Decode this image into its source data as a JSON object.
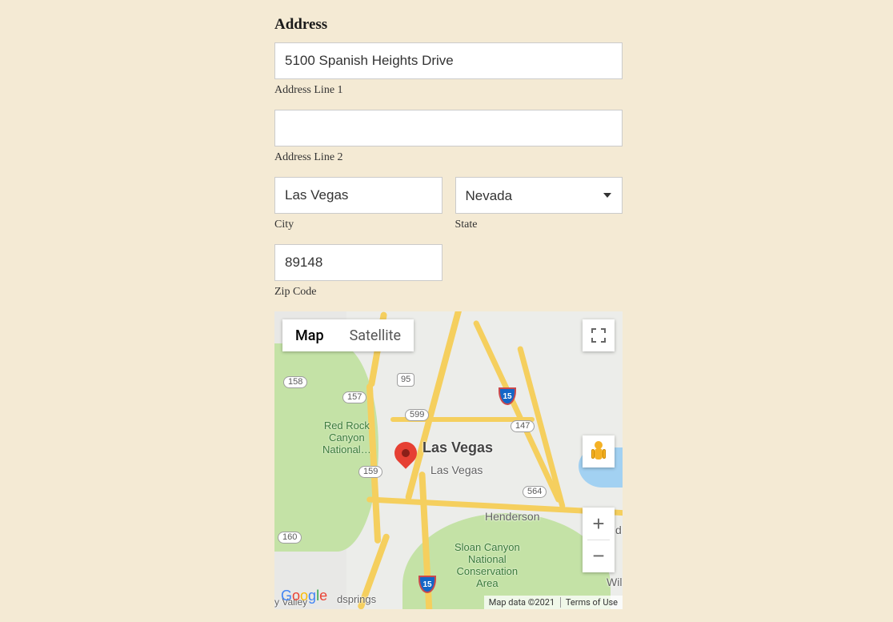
{
  "form": {
    "heading": "Address",
    "address1": {
      "label": "Address Line 1",
      "value": "5100 Spanish Heights Drive"
    },
    "address2": {
      "label": "Address Line 2",
      "value": ""
    },
    "city": {
      "label": "City",
      "value": "Las Vegas"
    },
    "state": {
      "label": "State",
      "value": "Nevada"
    },
    "zip": {
      "label": "Zip Code",
      "value": "89148"
    }
  },
  "map": {
    "tabs": {
      "map": "Map",
      "satellite": "Satellite"
    },
    "places": {
      "primary": "Las Vegas",
      "secondary": "Las Vegas",
      "henderson": "Henderson",
      "boulder": "Bould",
      "wil": "Wil",
      "goodsprings": "dsprings",
      "valley": "y Valley"
    },
    "parks": {
      "redrock": "Red Rock\nCanyon\nNational…",
      "sloan": "Sloan Canyon\nNational\nConservation\nArea"
    },
    "shields": {
      "s158": "158",
      "s157": "157",
      "s159": "159",
      "s160": "160",
      "s95": "95",
      "s599": "599",
      "s147": "147",
      "s564": "564",
      "i15": "15"
    },
    "attribution": {
      "data": "Map data ©2021",
      "terms": "Terms of Use"
    },
    "logo_letters": [
      "G",
      "o",
      "o",
      "g",
      "l",
      "e"
    ]
  }
}
